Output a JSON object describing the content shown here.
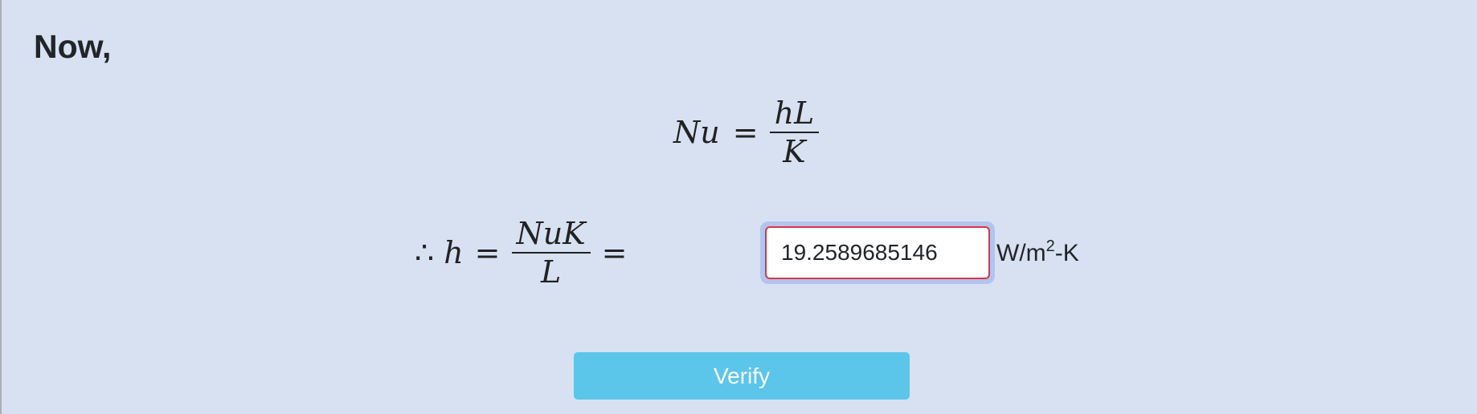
{
  "heading": "Now,",
  "equation1": {
    "lhs": "Nu",
    "equals": "=",
    "numerator": "hL",
    "denominator": "K"
  },
  "equation2": {
    "therefore": "∴",
    "lhs": "h",
    "equals": "=",
    "numerator": "NuK",
    "denominator": "L",
    "equals2": "="
  },
  "answer": {
    "value": "19.2589685146"
  },
  "unit": {
    "prefix": "W/m",
    "superscript": "2",
    "suffix": "-K"
  },
  "verify_button": {
    "label": "Verify"
  },
  "colors": {
    "background": "#d7e1f2",
    "button": "#5bc6e9",
    "input_border_error": "#dc3545",
    "input_focus_ring": "#b3c4ef"
  }
}
